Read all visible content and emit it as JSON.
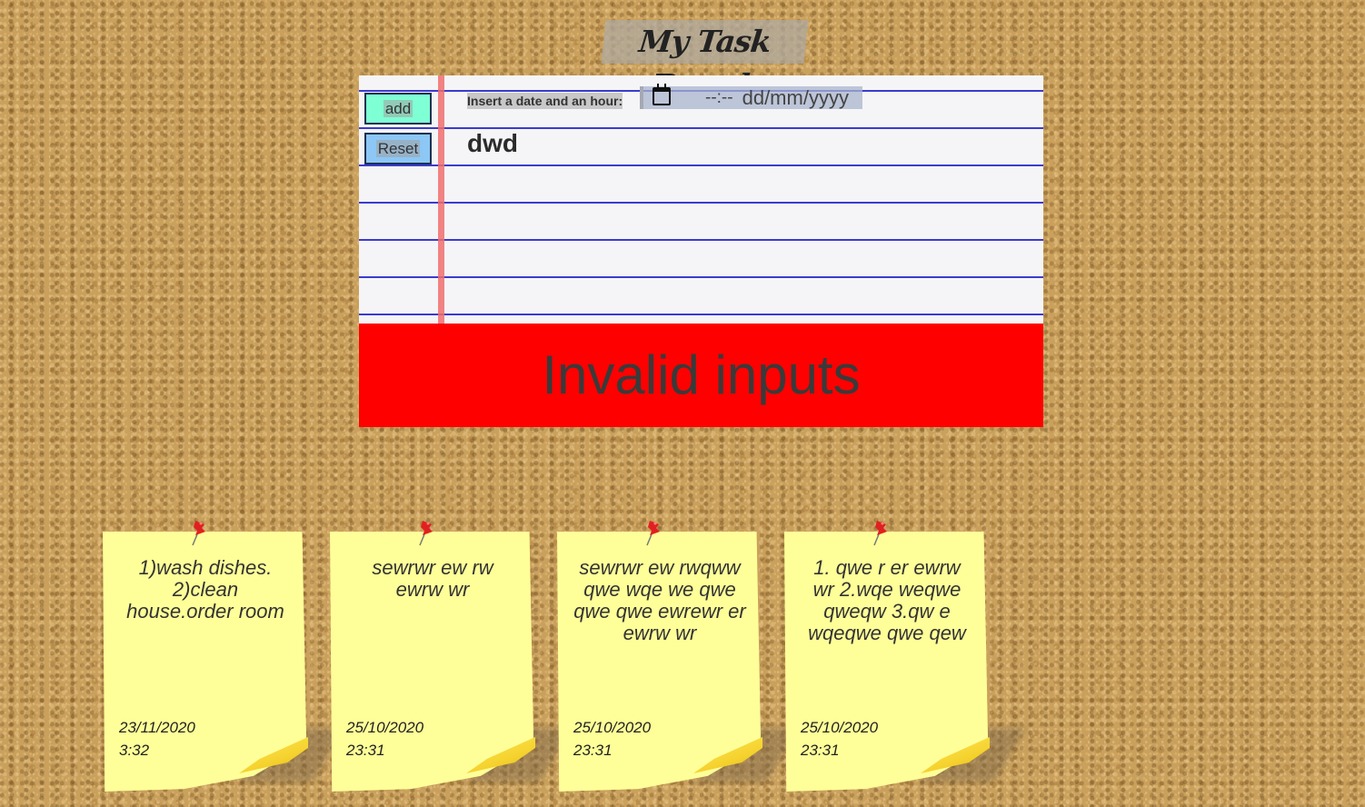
{
  "header": {
    "title": "My Task Board"
  },
  "form": {
    "add_label": "add",
    "reset_label": "Reset",
    "date_label": "Insert a date and an hour:",
    "time_placeholder": "--:--",
    "date_placeholder": "dd/mm/yyyy",
    "task_text": "dwd"
  },
  "error": {
    "message": "Invalid inputs",
    "color": "#ff0000"
  },
  "notes": [
    {
      "text": "1)wash dishes. 2)clean house.order room",
      "date": "23/11/2020",
      "time": "3:32"
    },
    {
      "text": "sewrwr ew rw ewrw wr",
      "date": "25/10/2020",
      "time": "23:31"
    },
    {
      "text": "sewrwr ew rwqww qwe wqe we qwe qwe qwe ewrewr er ewrw wr",
      "date": "25/10/2020",
      "time": "23:31"
    },
    {
      "text": "1. qwe r er ewrw wr 2.wqe weqwe qweqw 3.qw e wqeqwe qwe qew",
      "date": "25/10/2020",
      "time": "23:31"
    }
  ],
  "icons": {
    "pin": "pushpin-icon",
    "calendar": "calendar-icon"
  },
  "colors": {
    "note_background": "#ffff99",
    "add_button": "#7fffd4",
    "reset_button": "#8cc7f5",
    "paper_lines": "#3b3bcf"
  }
}
